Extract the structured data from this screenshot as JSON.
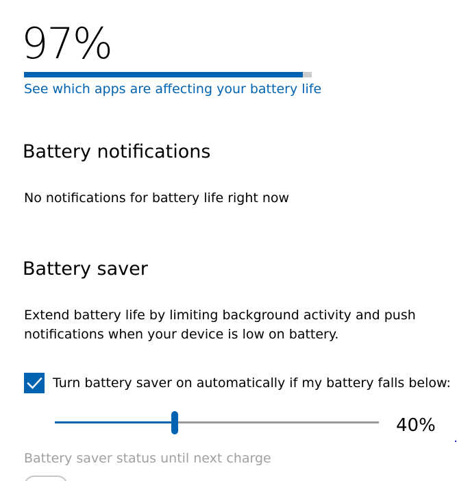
{
  "battery": {
    "percent_label": "97%",
    "level": 0.97,
    "apps_link": "See which apps are affecting your battery life"
  },
  "notifications": {
    "heading": "Battery notifications",
    "text": "No notifications for battery life right now"
  },
  "saver": {
    "heading": "Battery saver",
    "description": "Extend battery life by limiting background activity and push notifications when your device is low on battery.",
    "auto_checkbox_label": "Turn battery saver on automatically if my battery falls below:",
    "auto_checked": true,
    "threshold_value": 0.37,
    "threshold_label": "40%",
    "status_label": "Battery saver status until next charge",
    "status_on": false
  },
  "colors": {
    "accent": "#0063b1",
    "track": "#999999",
    "bar_background": "#cccccc",
    "disabled_text": "#a0a0a0"
  },
  "icons": {
    "checkbox": "checkmark-icon"
  }
}
